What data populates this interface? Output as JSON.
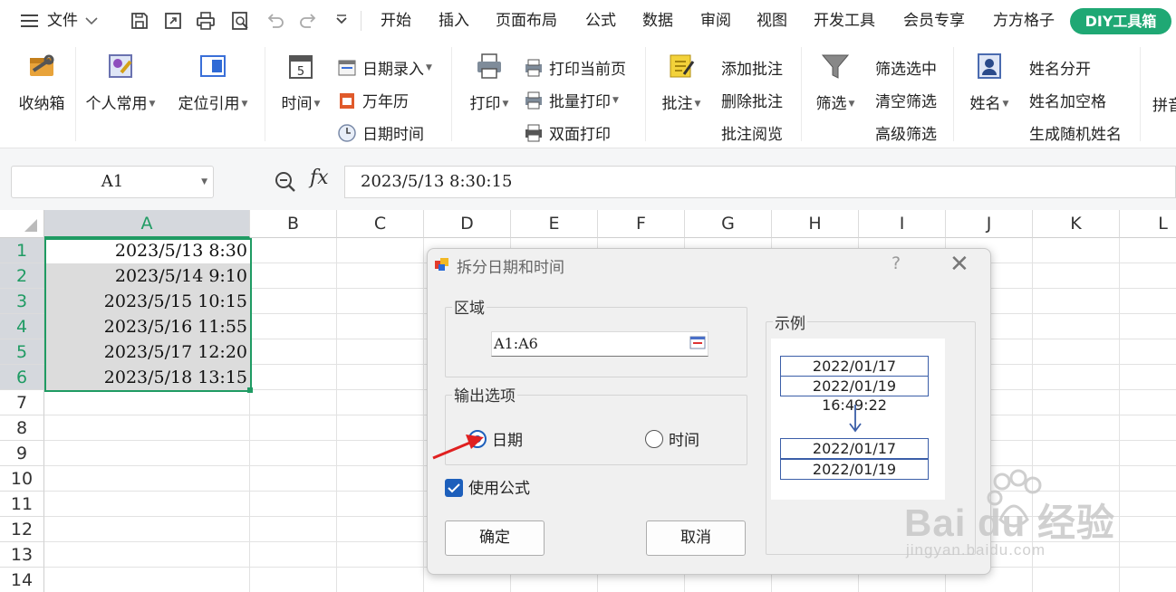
{
  "menu": {
    "hamburger_label": "文件",
    "tabs": [
      "开始",
      "插入",
      "页面布局",
      "公式",
      "数据",
      "审阅",
      "视图",
      "开发工具",
      "会员专享",
      "方方格子"
    ],
    "diy_label": "DIY工具箱"
  },
  "ribbon": {
    "storage_box": "收纳箱",
    "personal_common": "个人常用",
    "locate_ref": "定位引用",
    "time": "时间",
    "date_entry": "日期录入",
    "perpetual_calendar": "万年历",
    "date_time": "日期时间",
    "print": "打印",
    "print_current_page": "打印当前页",
    "batch_print": "批量打印",
    "duplex_print": "双面打印",
    "comment": "批注",
    "add_comment": "添加批注",
    "delete_comment": "删除批注",
    "view_comment": "批注阅览",
    "filter": "筛选",
    "filter_selected": "筛选选中",
    "clear_filter": "清空筛选",
    "advanced_filter": "高级筛选",
    "name": "姓名",
    "split_name": "姓名分开",
    "name_add_space": "姓名加空格",
    "random_name": "生成随机姓名",
    "pinyin": "拼音"
  },
  "formula_bar": {
    "name_box": "A1",
    "fx": "fx",
    "formula": "2023/5/13 8:30:15"
  },
  "grid": {
    "columns": [
      "A",
      "B",
      "C",
      "D",
      "E",
      "F",
      "G",
      "H",
      "I",
      "J",
      "K",
      "L"
    ],
    "rows": [
      "1",
      "2",
      "3",
      "4",
      "5",
      "6",
      "7",
      "8",
      "9",
      "10",
      "11",
      "12",
      "13",
      "14"
    ],
    "col_a_values": [
      "2023/5/13 8:30",
      "2023/5/14 9:10",
      "2023/5/15 10:15",
      "2023/5/16 11:55",
      "2023/5/17 12:20",
      "2023/5/18 13:15"
    ]
  },
  "dialog": {
    "title": "拆分日期和时间",
    "help": "?",
    "close": "✕",
    "range_group": "区域",
    "range_value": "A1:A6",
    "output_group": "输出选项",
    "opt_date": "日期",
    "opt_time": "时间",
    "use_formula": "使用公式",
    "ok": "确定",
    "cancel": "取消",
    "example_group": "示例",
    "example_before": [
      "2022/01/17 16:49:20",
      "2022/01/19 16:49:22"
    ],
    "example_after": [
      "2022/01/17",
      "2022/01/19"
    ]
  },
  "watermark": {
    "text": "Bai du 经验",
    "url": "jingyan.baidu.com"
  },
  "colors": {
    "accent_green": "#1f9b63",
    "diy_green": "#1fa874",
    "radio_blue": "#1d5fbb",
    "arrow_red": "#e02020"
  }
}
